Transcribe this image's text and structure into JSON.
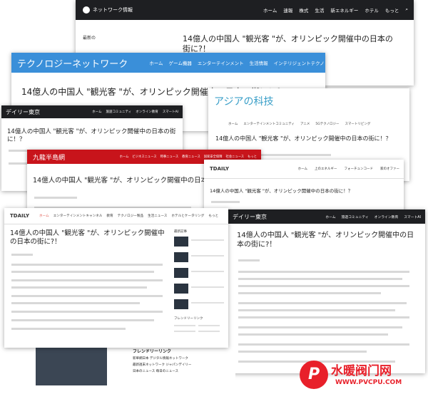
{
  "headline": "14億人の中国人 \"観光客 \"が、オリンピック開催中の日本の街に?！",
  "headline_short": "14億人の中国人 \"観光客 \"が、オリンピック開催中の日本の街に！？",
  "site1": {
    "logo": "ネットワーク情報",
    "nav": [
      "ホーム",
      "速報",
      "株式",
      "生活",
      "新エネルギー",
      "ホテル",
      "もっと"
    ],
    "side_title": "最新の"
  },
  "site2": {
    "logo": "テクノロジーネットワーク",
    "nav": [
      "ホーム",
      "ゲーム機器",
      "エンターテインメント",
      "生活情報",
      "インテリジェントテクノ"
    ]
  },
  "site3": {
    "logo": "アジアの科技",
    "nav": [
      "ホーム",
      "エンターテインメントコミュニティ",
      "アニメ",
      "5Gテクノロジー",
      "スマートリビング"
    ]
  },
  "site4": {
    "logo": "デイリー東京",
    "nav": [
      "ホーム",
      "旅遊コミュニティ",
      "オンライン教育",
      "スマートAI"
    ]
  },
  "site5": {
    "logo": "九龍半島網",
    "nav": [
      "ホーム",
      "ビジネスニュース",
      "時事ニュース",
      "教育ニュース",
      "国家安全保障",
      "社会ニュース",
      "もっと"
    ]
  },
  "site6": {
    "logo": "TDAILY",
    "nav": [
      "ホーム",
      "上のエネルギー",
      "フォーチュンコード",
      "家のオファー"
    ]
  },
  "site7": {
    "logo": "TDAILY",
    "nav": [
      "ホーム",
      "エンターテインメントキャンネル",
      "教育",
      "テクノロジー製品",
      "生活ニュース",
      "ホテルとケータリング",
      "もっと"
    ],
    "side_title": "最新記事",
    "links_title": "フレンドリーリンク"
  },
  "site8": {
    "logo": "デイリー東京",
    "nav": [
      "ホーム",
      "旅遊コミュニティ",
      "オンライン教育",
      "スマートAI"
    ]
  },
  "footer": {
    "title": "フレンドリーリンク",
    "links": [
      "新華網日本 デジタル情報ネットワーク",
      "最新週末ネットワーク ジャパンデイリー",
      "日本のニュース 毎日のニュース"
    ]
  },
  "watermark": {
    "text": "水暖阀门网",
    "url": "WWW.PVCPU.COM"
  },
  "colors": {
    "site2_bar": "#3a8fd9",
    "site5_bar": "#c8141b",
    "dark_bar": "#1e1f22"
  }
}
